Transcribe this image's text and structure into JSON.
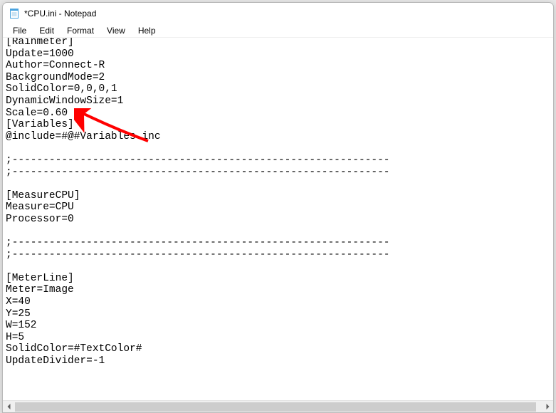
{
  "window": {
    "title": "*CPU.ini - Notepad"
  },
  "menu": {
    "file": "File",
    "edit": "Edit",
    "format": "Format",
    "view": "View",
    "help": "Help"
  },
  "document": {
    "content": "[Rainmeter]\nUpdate=1000\nAuthor=Connect-R\nBackgroundMode=2\nSolidColor=0,0,0,1\nDynamicWindowSize=1\nScale=0.60\n[Variables]\n@include=#@#Variables.inc\n\n;-------------------------------------------------------------\n;-------------------------------------------------------------\n\n[MeasureCPU]\nMeasure=CPU\nProcessor=0\n\n;-------------------------------------------------------------\n;-------------------------------------------------------------\n\n[MeterLine]\nMeter=Image\nX=40\nY=25\nW=152\nH=5\nSolidColor=#TextColor#\nUpdateDivider=-1"
  },
  "annotation": {
    "color": "#ff0000"
  }
}
